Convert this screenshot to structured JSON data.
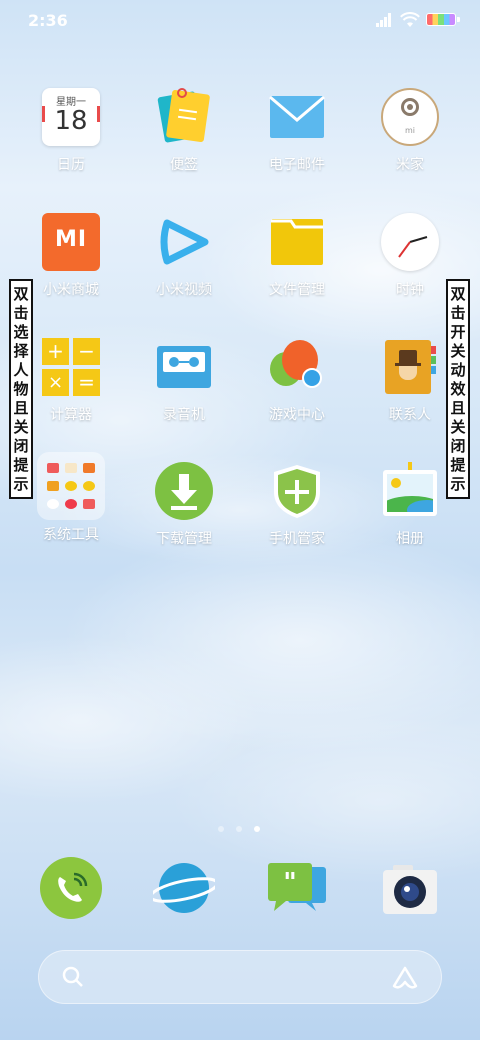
{
  "status_bar": {
    "time": "2:36"
  },
  "calendar_icon": {
    "weekday": "星期一",
    "day": "18"
  },
  "apps": [
    {
      "label": "日历"
    },
    {
      "label": "便签"
    },
    {
      "label": "电子邮件"
    },
    {
      "label": "米家"
    },
    {
      "label": "小米商城"
    },
    {
      "label": "小米视频"
    },
    {
      "label": "文件管理"
    },
    {
      "label": "时钟"
    },
    {
      "label": "计算器"
    },
    {
      "label": "录音机"
    },
    {
      "label": "游戏中心"
    },
    {
      "label": "联系人"
    },
    {
      "label": "系统工具"
    },
    {
      "label": "下载管理"
    },
    {
      "label": "手机管家"
    },
    {
      "label": "相册"
    }
  ],
  "left_note": "双击选择人物且关闭提示",
  "right_note": "双击开关动效且关闭提示",
  "page_indicator": {
    "count": 3,
    "active": 3
  },
  "dock": [
    {
      "icon": "phone-icon"
    },
    {
      "icon": "browser-icon"
    },
    {
      "icon": "messages-icon"
    },
    {
      "icon": "camera-icon"
    }
  ]
}
